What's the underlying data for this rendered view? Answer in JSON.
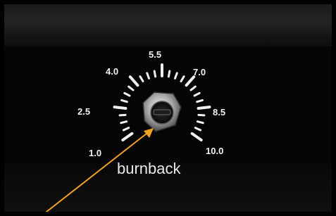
{
  "dial": {
    "scale_labels": [
      "1.0",
      "2.5",
      "4.0",
      "5.5",
      "7.0",
      "8.5",
      "10.0"
    ],
    "control_label": "burnback"
  },
  "annotation": {
    "arrow_color": "#f5a21b"
  }
}
